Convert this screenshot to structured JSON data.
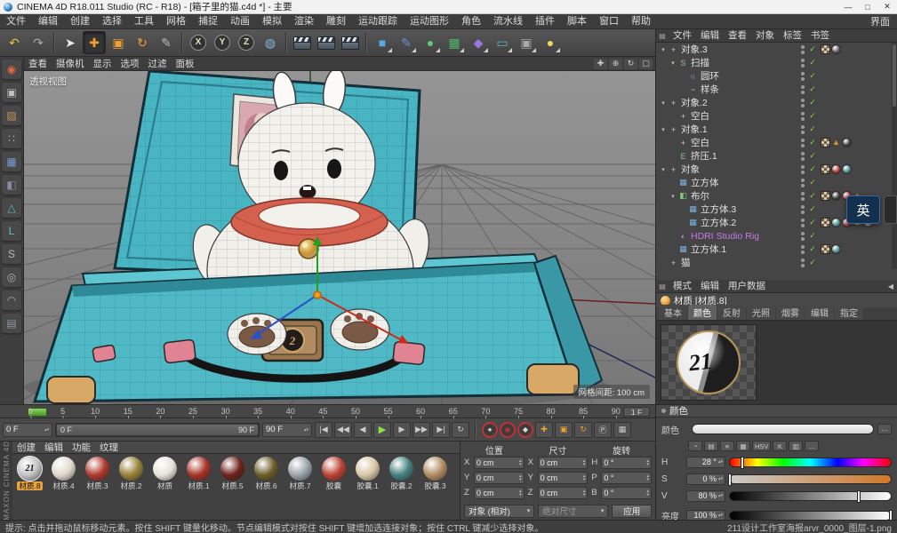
{
  "title_bar": {
    "title": "CINEMA 4D R18.011 Studio (RC - R18) - [箱子里的猫.c4d *] - 主要",
    "window_buttons": [
      {
        "name": "minimize-button",
        "glyph": "—"
      },
      {
        "name": "maximize-button",
        "glyph": "□"
      },
      {
        "name": "close-button",
        "glyph": "✕"
      }
    ]
  },
  "menu_bar": {
    "items": [
      "文件",
      "编辑",
      "创建",
      "选择",
      "工具",
      "网格",
      "捕捉",
      "动画",
      "模拟",
      "渲染",
      "雕刻",
      "运动跟踪",
      "运动图形",
      "角色",
      "流水线",
      "插件",
      "脚本",
      "窗口",
      "帮助"
    ],
    "right_item": "界面"
  },
  "main_toolbar": {
    "icons": [
      {
        "name": "undo-button",
        "glyph": "↶",
        "color": "#e0c040"
      },
      {
        "name": "redo-button",
        "glyph": "↷",
        "color": "#aaaaaa"
      },
      {
        "sep": true
      },
      {
        "name": "live-selection-tool",
        "glyph": "➤",
        "color": "#e8e8e8"
      },
      {
        "name": "move-tool",
        "glyph": "✚",
        "color": "#f0a030",
        "active": true
      },
      {
        "name": "scale-tool",
        "glyph": "▣",
        "color": "#f0a030"
      },
      {
        "name": "rotate-tool",
        "glyph": "↻",
        "color": "#f0a030"
      },
      {
        "name": "last-used-tool",
        "glyph": "✎",
        "color": "#b8b8b8"
      },
      {
        "sep": true
      },
      {
        "name": "lock-x-axis-button",
        "glyph": "X",
        "circle": true
      },
      {
        "name": "lock-y-axis-button",
        "glyph": "Y",
        "circle": true
      },
      {
        "name": "lock-z-axis-button",
        "glyph": "Z",
        "circle": true
      },
      {
        "name": "coordinate-system-button",
        "glyph": "◍",
        "color": "#80b8e0"
      },
      {
        "sep": true
      },
      {
        "name": "render-view-button",
        "kind": "clapper"
      },
      {
        "name": "render-picture-viewer-button",
        "kind": "clapper"
      },
      {
        "name": "render-settings-button",
        "kind": "clapper"
      },
      {
        "sep": true
      },
      {
        "name": "add-cube-menu",
        "glyph": "■",
        "color": "#58a8e8",
        "menu": true
      },
      {
        "name": "add-spline-menu",
        "glyph": "✎",
        "color": "#6890e0",
        "menu": true
      },
      {
        "name": "add-generator-menu",
        "glyph": "●",
        "color": "#60c878",
        "menu": true
      },
      {
        "name": "add-mograph-menu",
        "glyph": "▦",
        "color": "#50b868",
        "menu": true
      },
      {
        "name": "add-deformer-menu",
        "glyph": "◆",
        "color": "#9878e0",
        "menu": true
      },
      {
        "name": "add-environment-menu",
        "glyph": "▭",
        "color": "#50b8c8",
        "menu": true
      },
      {
        "name": "add-camera-menu",
        "glyph": "▣",
        "color": "#a8a8a8",
        "menu": true
      },
      {
        "name": "add-light-menu",
        "glyph": "●",
        "color": "#f0d860",
        "menu": true
      }
    ]
  },
  "left_toolbar": {
    "icons": [
      {
        "name": "convert-object-button",
        "glyph": "◉",
        "color": "#e06844"
      },
      {
        "name": "make-editable-button",
        "glyph": "▣",
        "color": "#c0c0c0"
      },
      {
        "name": "model-mode-button",
        "glyph": "▨",
        "color": "#c89058"
      },
      {
        "name": "texture-mode-button",
        "glyph": "∷",
        "color": "#a8a8a8"
      },
      {
        "name": "points-mode-button",
        "glyph": "▦",
        "color": "#7898c8"
      },
      {
        "name": "edges-mode-button",
        "glyph": "◧",
        "color": "#8888a8"
      },
      {
        "name": "polygons-mode-button",
        "glyph": "△",
        "color": "#58b8c0"
      },
      {
        "name": "workplane-mode-button",
        "glyph": "L",
        "color": "#58c0c8"
      },
      {
        "name": "sculpt-mode-button",
        "glyph": "S",
        "color": "#b8b8b8"
      },
      {
        "name": "torus-mode-button",
        "glyph": "◎",
        "color": "#b0b0b0"
      },
      {
        "name": "lock-button",
        "glyph": "◠",
        "color": "#a8a8a8"
      },
      {
        "name": "snap-grid-button",
        "glyph": "▤",
        "color": "#9098a0"
      }
    ]
  },
  "viewport": {
    "menus": [
      "查看",
      "摄像机",
      "显示",
      "选项",
      "过滤",
      "面板"
    ],
    "nav_icons": [
      {
        "name": "pan-view-icon",
        "glyph": "✚"
      },
      {
        "name": "zoom-view-icon",
        "glyph": "⊕"
      },
      {
        "name": "rotate-view-icon",
        "glyph": "↻"
      },
      {
        "name": "toggle-view-icon",
        "glyph": "▢"
      }
    ],
    "view_label": "透视视图",
    "grid_spacing_label": "网格间距: 100 cm"
  },
  "object_manager": {
    "menus": [
      "文件",
      "编辑",
      "查看",
      "对象",
      "标签",
      "书签"
    ],
    "rows": [
      {
        "label": "对象.3",
        "depth": 0,
        "arrow": "▾",
        "glyph": "+",
        "glyph_color": "#c8c8c8",
        "icon": "null-object",
        "check": true,
        "tags": [
          "checker",
          "ball:#606060"
        ]
      },
      {
        "label": "扫描",
        "depth": 1,
        "arrow": "▾",
        "glyph": "S",
        "glyph_color": "#84c884",
        "icon": "sweep-object",
        "check": true,
        "tags": []
      },
      {
        "label": "圆环",
        "depth": 2,
        "arrow": "",
        "glyph": "○",
        "glyph_color": "#9ec2ec",
        "icon": "circle-spline",
        "check": true,
        "tags": []
      },
      {
        "label": "样条",
        "depth": 2,
        "arrow": "",
        "glyph": "~",
        "glyph_color": "#9ec2ec",
        "icon": "spline-object",
        "check": true,
        "tags": []
      },
      {
        "label": "对象.2",
        "depth": 0,
        "arrow": "▾",
        "glyph": "+",
        "glyph_color": "#c8c8c8",
        "icon": "null-object",
        "check": true,
        "tags": []
      },
      {
        "label": "空白",
        "depth": 1,
        "arrow": "",
        "glyph": "+",
        "glyph_color": "#c8c8c8",
        "icon": "null-object",
        "check": true,
        "tags": []
      },
      {
        "label": "对象.1",
        "depth": 0,
        "arrow": "▾",
        "glyph": "+",
        "glyph_color": "#c8c8c8",
        "icon": "null-object",
        "check": true,
        "tags": []
      },
      {
        "label": "空白",
        "depth": 1,
        "arrow": "",
        "glyph": "+",
        "glyph_color": "#c8c8c8",
        "icon": "null-object",
        "check": true,
        "tags": [
          "checker",
          "tri",
          "ball:#404040"
        ]
      },
      {
        "label": "挤压.1",
        "depth": 1,
        "arrow": "",
        "glyph": "E",
        "glyph_color": "#84c884",
        "icon": "extrude-object",
        "check": true,
        "tags": []
      },
      {
        "label": "对象",
        "depth": 0,
        "arrow": "▾",
        "glyph": "+",
        "glyph_color": "#c8c8c8",
        "icon": "null-object",
        "check": true,
        "tags": [
          "checker",
          "ball:#b04038",
          "ball:#4e8d8a"
        ]
      },
      {
        "label": "立方体",
        "depth": 1,
        "arrow": "",
        "glyph": "▦",
        "glyph_color": "#7ab2e0",
        "icon": "cube-object",
        "check": true,
        "tags": []
      },
      {
        "label": "布尔",
        "depth": 1,
        "arrow": "▾",
        "glyph": "◧",
        "glyph_color": "#84c884",
        "icon": "boole-object",
        "check": true,
        "tags": [
          "checker",
          "ball:#404040",
          "ball:#b04038",
          "tri"
        ]
      },
      {
        "label": "立方体.3",
        "depth": 2,
        "arrow": "",
        "glyph": "▦",
        "glyph_color": "#7ab2e0",
        "icon": "cube-object",
        "check": true,
        "tags": []
      },
      {
        "label": "立方体.2",
        "depth": 2,
        "arrow": "",
        "glyph": "▦",
        "glyph_color": "#7ab2e0",
        "icon": "cube-object",
        "check": true,
        "tags": [
          "checker",
          "ball:#4e8d8a",
          "ball:#b04038",
          "tri",
          "ball:#909090"
        ]
      },
      {
        "label": "HDRI Studio Rig",
        "depth": 1,
        "arrow": "",
        "glyph": "◐",
        "glyph_color": "#c77ae8",
        "icon": "hdri-rig-object",
        "check": true,
        "color": "#c77ae8",
        "tags": []
      },
      {
        "label": "立方体.1",
        "depth": 1,
        "arrow": "",
        "glyph": "▦",
        "glyph_color": "#7ab2e0",
        "icon": "cube-object",
        "check": true,
        "tags": [
          "checker",
          "ball:#4e8d8a"
        ]
      },
      {
        "label": "猫",
        "depth": 0,
        "arrow": "",
        "glyph": "+",
        "glyph_color": "#c8c8c8",
        "icon": "null-object",
        "check": true,
        "tags": []
      }
    ]
  },
  "attribute_manager": {
    "menus": [
      "模式",
      "编辑",
      "用户数据"
    ],
    "collapse_arrow": "◀",
    "title": "材质 [材质.8]",
    "tabs": [
      "基本",
      "颜色",
      "反射",
      "光照",
      "烟雾",
      "编辑",
      "指定"
    ],
    "active_tab": "颜色",
    "preview_logo": "21",
    "color_section": {
      "header": "颜色",
      "swatch_label": "颜色",
      "texture_button": "…",
      "mode_buttons": [
        "◔",
        "▤",
        "≡",
        "▦",
        "HSV",
        "K",
        "▥",
        "…"
      ],
      "h_label": "H",
      "h_value": "28 °",
      "h_percent": 7.8,
      "s_label": "S",
      "s_value": "0 %",
      "s_percent": 0,
      "v_label": "V",
      "v_value": "80 %",
      "v_percent": 80,
      "brightness_label": "亮度",
      "brightness_value": "100 %",
      "brightness_percent": 100
    }
  },
  "timeline": {
    "ticks": [
      0,
      5,
      10,
      15,
      20,
      25,
      30,
      35,
      40,
      45,
      50,
      55,
      60,
      65,
      70,
      75,
      80,
      85,
      90
    ],
    "frame_step_label": "1 F",
    "current_frame_label": "0 F",
    "range_start_label": "0 F",
    "range_end_label": "90 F",
    "end_frame_label": "90 F",
    "transport": [
      {
        "name": "goto-start-button",
        "glyph": "|◀"
      },
      {
        "name": "prev-key-button",
        "glyph": "◀◀"
      },
      {
        "name": "prev-frame-button",
        "glyph": "◀"
      },
      {
        "name": "play-button",
        "glyph": "▶",
        "green": true
      },
      {
        "name": "next-frame-button",
        "glyph": "▶"
      },
      {
        "name": "next-key-button",
        "glyph": "▶▶"
      },
      {
        "name": "goto-end-button",
        "glyph": "▶|"
      },
      {
        "name": "play-mode-button",
        "glyph": "↻"
      }
    ],
    "record": [
      {
        "name": "record-keyframe-button",
        "glyph": "●",
        "rec": true,
        "color": "#d8d8d8"
      },
      {
        "name": "autokeying-button",
        "glyph": "◉",
        "rec": true,
        "color": "#c03030"
      },
      {
        "name": "keyframe-selection-button",
        "glyph": "◆",
        "rec": true,
        "color": "#d8d8d8"
      },
      {
        "name": "record-position-toggle",
        "glyph": "✚",
        "color": "#f0a030"
      },
      {
        "name": "record-scale-toggle",
        "glyph": "▣",
        "color": "#f0a030"
      },
      {
        "name": "record-rotation-toggle",
        "glyph": "↻",
        "color": "#f0a030"
      },
      {
        "name": "record-parameter-toggle",
        "glyph": "Ⓟ",
        "color": "#d8d8d8"
      },
      {
        "name": "record-pla-toggle",
        "glyph": "▦",
        "color": "#c8c8c8"
      }
    ]
  },
  "material_manager": {
    "menus": [
      "创建",
      "编辑",
      "功能",
      "纹理"
    ],
    "materials": [
      {
        "label": "材质.8",
        "color": "#c4c4c4",
        "logo": "21",
        "selected": true
      },
      {
        "label": "材质.4",
        "color": "#ded8cc"
      },
      {
        "label": "材质.3",
        "color": "#b03a2e"
      },
      {
        "label": "材质.2",
        "color": "#96803a"
      },
      {
        "label": "材质",
        "color": "#e6e2d8"
      },
      {
        "label": "材质.1",
        "color": "#a83428"
      },
      {
        "label": "材质.5",
        "color": "#6e241c"
      },
      {
        "label": "材质.6",
        "color": "#6e5e28"
      },
      {
        "label": "材质.7",
        "color": "#9aa2aa"
      },
      {
        "label": "胶囊",
        "color": "#bb4434"
      },
      {
        "label": "胶囊.1",
        "color": "#d6c6a4"
      },
      {
        "label": "胶囊.2",
        "color": "#45817e"
      },
      {
        "label": "胶囊.3",
        "color": "#b08b62"
      }
    ]
  },
  "coordinates": {
    "groups": [
      {
        "title": "位置",
        "rows": [
          [
            "X",
            "0 cm"
          ],
          [
            "Y",
            "0 cm"
          ],
          [
            "Z",
            "0 cm"
          ]
        ]
      },
      {
        "title": "尺寸",
        "rows": [
          [
            "X",
            "0 cm"
          ],
          [
            "Y",
            "0 cm"
          ],
          [
            "Z",
            "0 cm"
          ]
        ]
      },
      {
        "title": "旋转",
        "rows": [
          [
            "H",
            "0 °"
          ],
          [
            "P",
            "0 °"
          ],
          [
            "B",
            "0 °"
          ]
        ]
      }
    ],
    "mode_dropdown": "对象 (相对)",
    "size_dropdown": "绝对尺寸",
    "apply_button": "应用"
  },
  "status_bar": {
    "text": "提示: 点击并拖动鼠标移动元素。按住 SHIFT 键量化移动。节点编辑模式对按住 SHIFT 键增加选连接对象；按住 CTRL 键减少选择对象。",
    "right_text": "211设计工作室海报arvr_0000_图层-1.png"
  },
  "branding": {
    "vertical_text": "MAXON CINEMA 4D"
  },
  "ime": {
    "label": "英"
  },
  "colors": {
    "accent_orange": "#e8a33d",
    "check_green": "#8cd03c",
    "hdri_purple": "#c77ae8",
    "suitcase_teal": "#4fb9c6"
  }
}
